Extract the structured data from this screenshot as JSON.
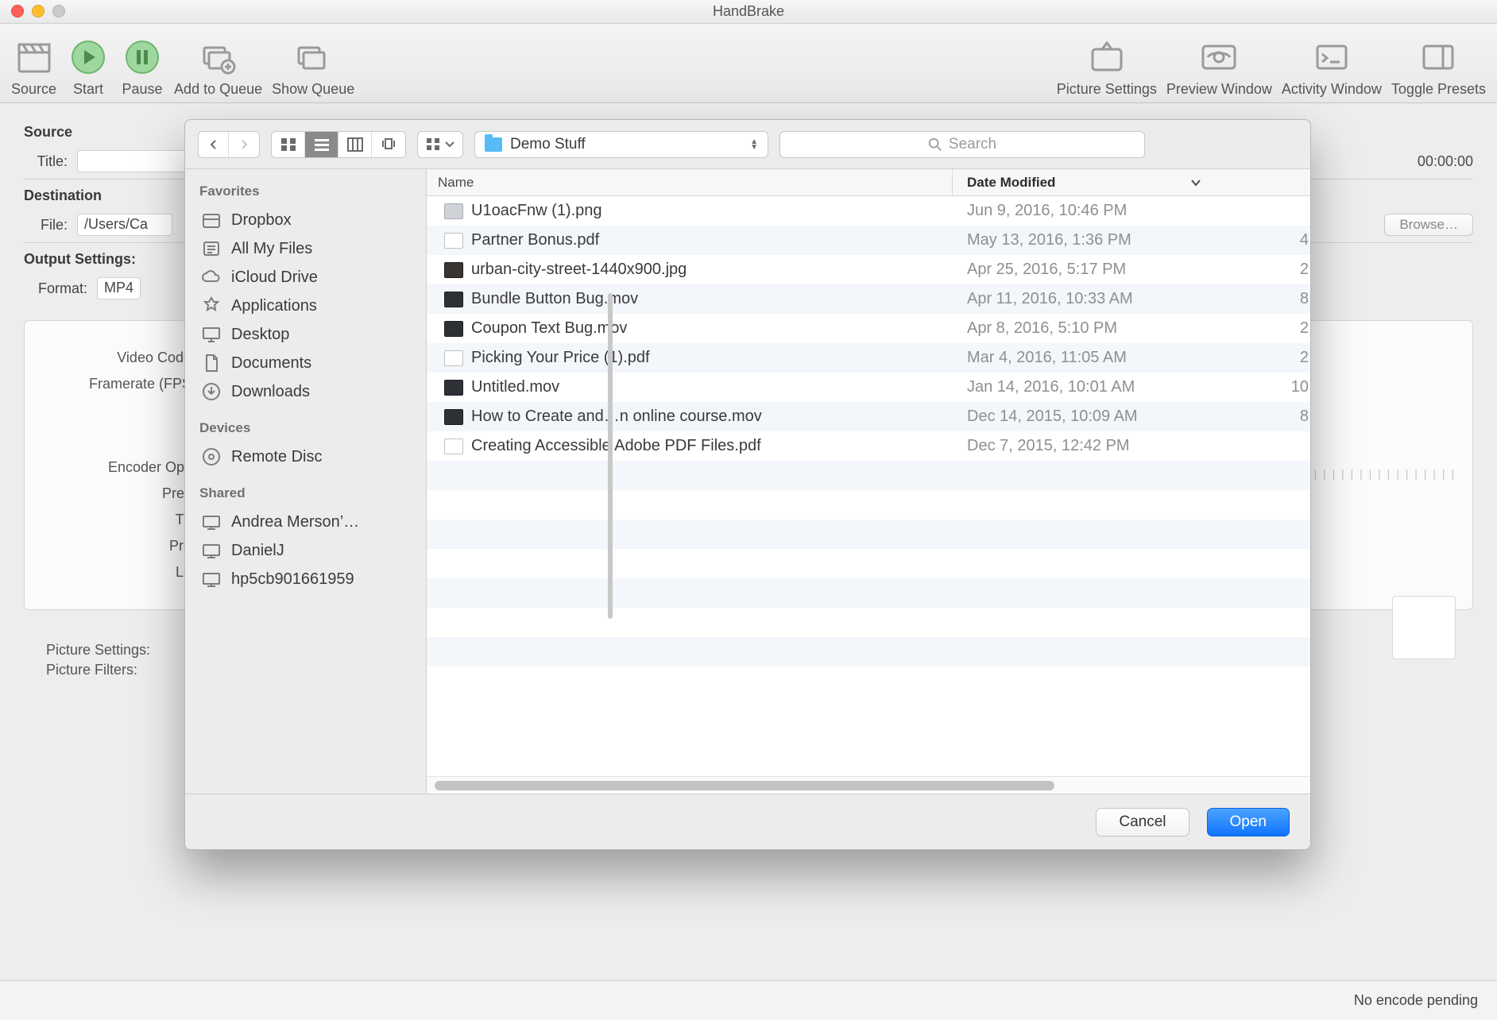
{
  "window": {
    "title": "HandBrake"
  },
  "toolbar": {
    "source": "Source",
    "start": "Start",
    "pause": "Pause",
    "addq": "Add to Queue",
    "showq": "Show Queue",
    "picset": "Picture Settings",
    "preview": "Preview Window",
    "activity": "Activity Window",
    "toggle": "Toggle Presets"
  },
  "main": {
    "source_head": "Source",
    "title_lbl": "Title:",
    "duration": "00:00:00",
    "dest_head": "Destination",
    "file_lbl": "File:",
    "file_val": "/Users/Ca",
    "browse": "Browse…",
    "output_head": "Output Settings:",
    "format_lbl": "Format:",
    "format_val": "MP4 ",
    "vcodec": "Video Code",
    "fps": "Framerate (FPS",
    "encopt": "Encoder Opti",
    "preset": "Pres",
    "tune": "Tu",
    "profile": "Pro",
    "level": "Le",
    "picset": "Picture Settings:",
    "picfilt": "Picture Filters:"
  },
  "status": {
    "text": "No encode pending"
  },
  "dialog": {
    "nav_path": "Demo Stuff",
    "search_placeholder": "Search",
    "col_name": "Name",
    "col_date": "Date Modified",
    "sidebar": {
      "fav": "Favorites",
      "dev": "Devices",
      "shr": "Shared",
      "items_fav": [
        "Dropbox",
        "All My Files",
        "iCloud Drive",
        "Applications",
        "Desktop",
        "Documents",
        "Downloads"
      ],
      "items_dev": [
        "Remote Disc"
      ],
      "items_shr": [
        "Andrea  Merson’…",
        "DanielJ",
        "hp5cb901661959"
      ]
    },
    "files": [
      {
        "n": "U1oacFnw (1).png",
        "d": "Jun 9, 2016, 10:46 PM",
        "k": "png",
        "x": ""
      },
      {
        "n": "Partner Bonus.pdf",
        "d": "May 13, 2016, 1:36 PM",
        "k": "pdf",
        "x": "4"
      },
      {
        "n": "urban-city-street-1440x900.jpg",
        "d": "Apr 25, 2016, 5:17 PM",
        "k": "jpg",
        "x": "2"
      },
      {
        "n": "Bundle Button Bug.mov",
        "d": "Apr 11, 2016, 10:33 AM",
        "k": "mov",
        "x": "8"
      },
      {
        "n": "Coupon Text Bug.mov",
        "d": "Apr 8, 2016, 5:10 PM",
        "k": "mov",
        "x": "2"
      },
      {
        "n": "Picking Your Price (1).pdf",
        "d": "Mar 4, 2016, 11:05 AM",
        "k": "pdf",
        "x": "2"
      },
      {
        "n": "Untitled.mov",
        "d": "Jan 14, 2016, 10:01 AM",
        "k": "mov",
        "x": "10"
      },
      {
        "n": "How to Create and…n online course.mov",
        "d": "Dec 14, 2015, 10:09 AM",
        "k": "mov",
        "x": "8"
      },
      {
        "n": "Creating Accessible Adobe PDF Files.pdf",
        "d": "Dec 7, 2015, 12:42 PM",
        "k": "pdf",
        "x": ""
      }
    ],
    "cancel": "Cancel",
    "open": "Open"
  }
}
